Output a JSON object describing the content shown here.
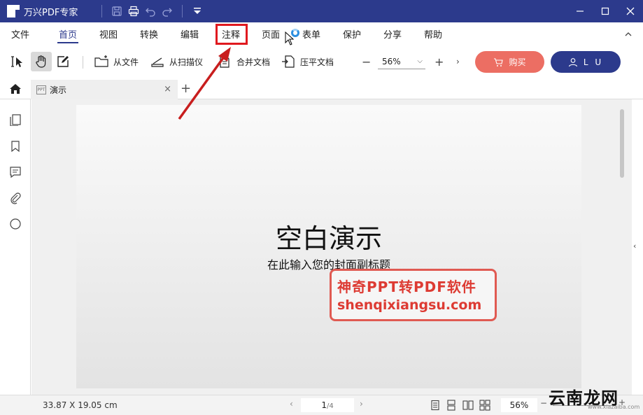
{
  "app": {
    "title": "万兴PDF专家"
  },
  "menu": {
    "items": [
      "文件",
      "首页",
      "视图",
      "转换",
      "编辑",
      "注释",
      "页面",
      "表单",
      "保护",
      "分享",
      "帮助"
    ],
    "active": "首页",
    "highlighted": "注释"
  },
  "toolbar": {
    "from_file": "从文件",
    "from_scanner": "从扫描仪",
    "merge": "合并文档",
    "flatten": "压平文档",
    "zoom": "56%",
    "buy": "购买",
    "user": "L U"
  },
  "tabs": {
    "doc_icon_text": "PPT",
    "doc_title": "演示"
  },
  "document": {
    "slide_title": "空白演示",
    "slide_subtitle": "在此输入您的封面副标题"
  },
  "watermark": {
    "line1": "神奇PPT转PDF软件",
    "line2": "shenqixiangsu.com"
  },
  "status": {
    "dimensions": "33.87 X 19.05 cm",
    "page_current": "1",
    "page_total": "/4",
    "zoom": "56%"
  },
  "site_logo": {
    "text": "云南龙网",
    "domain": "www.xiazaiba.com"
  },
  "colors": {
    "primary": "#2c3a8c",
    "buy": "#ec6e63",
    "highlight": "#e0191f",
    "watermark": "#dd3b33"
  }
}
